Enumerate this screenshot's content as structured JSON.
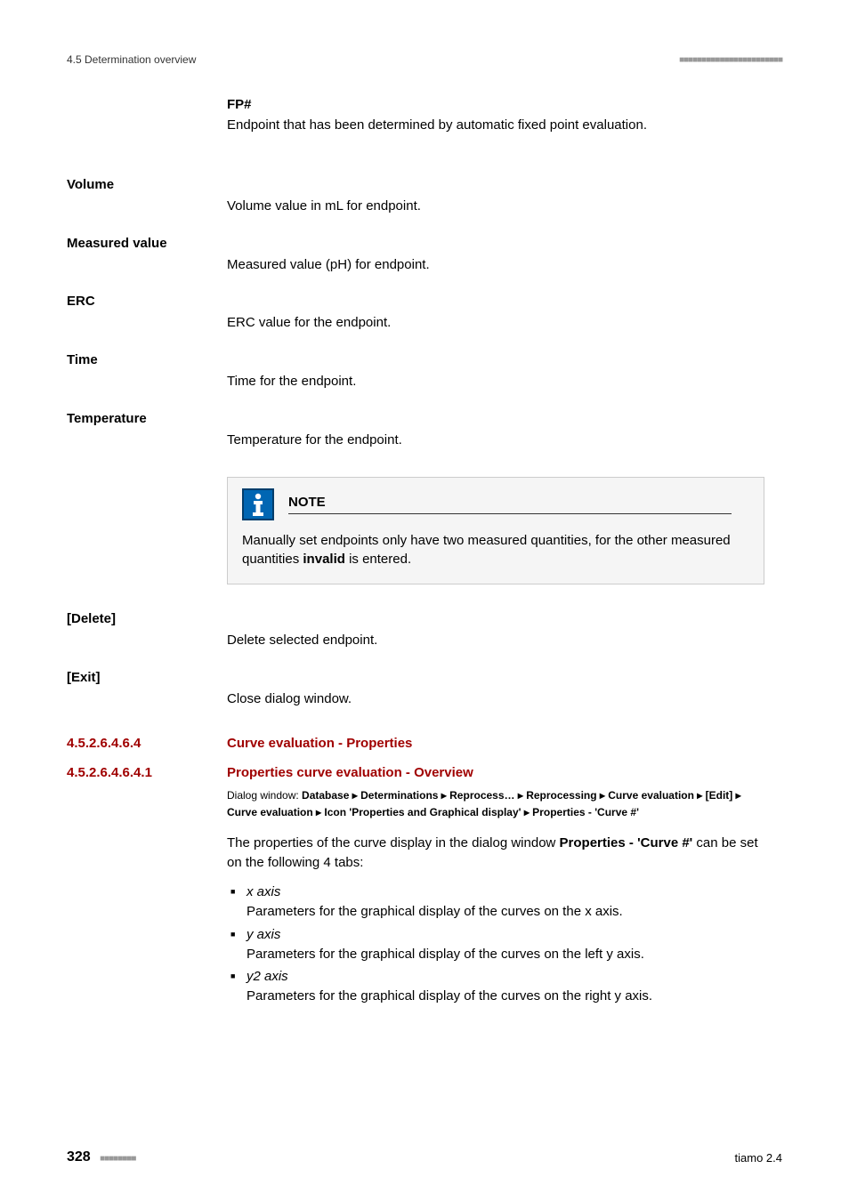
{
  "header": {
    "section": "4.5 Determination overview",
    "blocks": "■■■■■■■■■■■■■■■■■■■■■■■"
  },
  "fp": {
    "name": "FP#",
    "desc": "Endpoint that has been determined by automatic fixed point evaluation."
  },
  "items": [
    {
      "label": "Volume",
      "desc": "Volume value in mL for endpoint."
    },
    {
      "label": "Measured value",
      "desc": "Measured value (pH) for endpoint."
    },
    {
      "label": "ERC",
      "desc": "ERC value for the endpoint."
    },
    {
      "label": "Time",
      "desc": "Time for the endpoint."
    },
    {
      "label": "Temperature",
      "desc": "Temperature for the endpoint."
    }
  ],
  "note": {
    "title": "NOTE",
    "text_part1": "Manually set endpoints only have two measured quantities, for the other measured quantities ",
    "bold": "invalid",
    "text_part2": " is entered."
  },
  "buttons": [
    {
      "label": "[Delete]",
      "desc": "Delete selected endpoint."
    },
    {
      "label": "[Exit]",
      "desc": "Close dialog window."
    }
  ],
  "h1": {
    "num": "4.5.2.6.4.6.4",
    "text": "Curve evaluation - Properties"
  },
  "h2": {
    "num": "4.5.2.6.4.6.4.1",
    "text": "Properties curve evaluation - Overview"
  },
  "dialog_path": {
    "prefix": "Dialog window: ",
    "path": "Database ▸ Determinations ▸ Reprocess… ▸ Reprocessing ▸ Curve evaluation ▸ [Edit] ▸ Curve evaluation ▸ Icon 'Properties and Graphical display' ▸ Properties - 'Curve #'"
  },
  "props_intro": {
    "part1": "The properties of the curve display in the dialog window ",
    "bold": "Properties - 'Curve #'",
    "part2": " can be set on the following 4 tabs:"
  },
  "tabs": [
    {
      "name": "x axis",
      "desc": "Parameters for the graphical display of the curves on the x axis."
    },
    {
      "name": "y axis",
      "desc": "Parameters for the graphical display of the curves on the left y axis."
    },
    {
      "name": "y2 axis",
      "desc": "Parameters for the graphical display of the curves on the right y axis."
    }
  ],
  "footer": {
    "page": "328",
    "blocks": "■■■■■■■■",
    "product": "tiamo 2.4"
  }
}
